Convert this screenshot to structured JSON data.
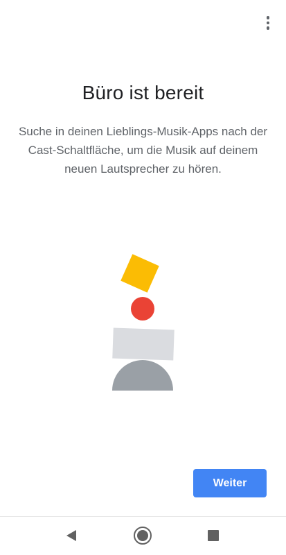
{
  "header": {
    "overflow_icon": "more-vert-icon"
  },
  "main": {
    "title": "Büro ist bereit",
    "description": "Suche in deinen Lieblings-Musik-Apps nach der Cast-Schaltfläche, um die Musik auf deinem neuen Lautsprecher zu hören."
  },
  "illustration": {
    "colors": {
      "square": "#fbbc04",
      "circle": "#ea4335",
      "block": "#dadce0",
      "dome": "#9aa0a6"
    }
  },
  "actions": {
    "next_label": "Weiter",
    "next_color": "#4285f4"
  },
  "nav": {
    "back_icon": "back-triangle-icon",
    "home_icon": "home-circle-icon",
    "recent_icon": "recents-square-icon"
  }
}
